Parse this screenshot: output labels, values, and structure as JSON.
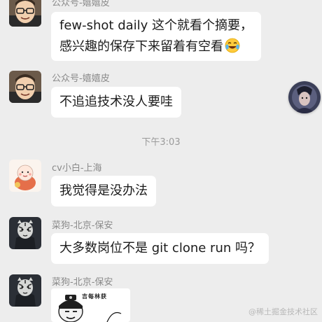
{
  "messages": [
    {
      "sender": "公众号-嬉嬉皮",
      "lines": [
        "few-shot daily 这个就看个摘要，",
        "感兴趣的保存下来留着有空看"
      ],
      "emoji": "laughing-crying-emoji"
    },
    {
      "sender": "公众号-嬉嬉皮",
      "lines": [
        "不追追技术没人要哇"
      ]
    },
    {
      "sender": "cv小白-上海",
      "lines": [
        "我觉得是没办法"
      ]
    },
    {
      "sender": "菜狗-北京-保安",
      "lines": [
        "大多数岗位不是 git clone run 吗？"
      ]
    },
    {
      "sender": "菜狗-北京-保安",
      "sticker_text": "吉每林获"
    }
  ],
  "timestamp": "下午3:03",
  "watermark": "@稀土掘金技术社区",
  "icons": [
    "cartoon-avatar-icon",
    "baby-avatar-icon",
    "tiger-avatar-icon",
    "character-avatar-icon",
    "laughing-crying-emoji"
  ],
  "colors": {
    "background": "#ededed",
    "bubble": "#ffffff",
    "meta_text": "#8a8a8a"
  }
}
